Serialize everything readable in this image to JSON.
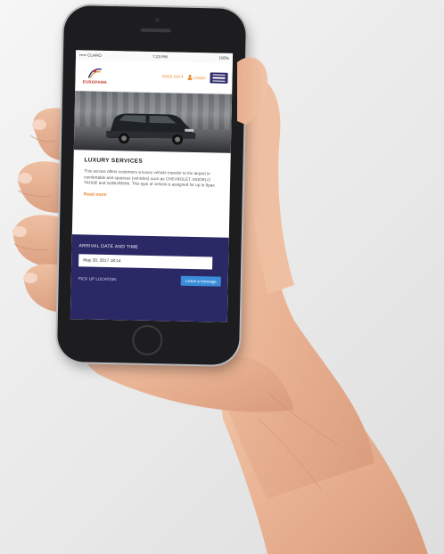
{
  "status": {
    "carrier": "••••• CLARO",
    "time": "7:23 PM",
    "battery": "100%"
  },
  "brand": {
    "name": "EUROPAWA",
    "accent": "#e98a2c",
    "navy": "#2b2866"
  },
  "nav": {
    "language": "ENGLISH ▾",
    "login": "LOGIN",
    "menu_icon": "hamburger-icon"
  },
  "hero": {
    "image": "black luxury SUV parked in front of building"
  },
  "service": {
    "title": "LUXURY SERVICES",
    "body": "This service offers customers a luxury vehicle transfer to the airport in comfortable and spacious (vehicles) such as CHEVROLET, MODELO TAHOE and SUBURBAN. This type of vehicle is assigned for up to 5pax.",
    "read_more": "Read more"
  },
  "booking": {
    "arrival_label": "ARRIVAL DATE AND TIME",
    "arrival_value": "May 20, 2017 18:14",
    "pickup_label": "PICK UP LOCATION",
    "cta": "Leave a message"
  }
}
